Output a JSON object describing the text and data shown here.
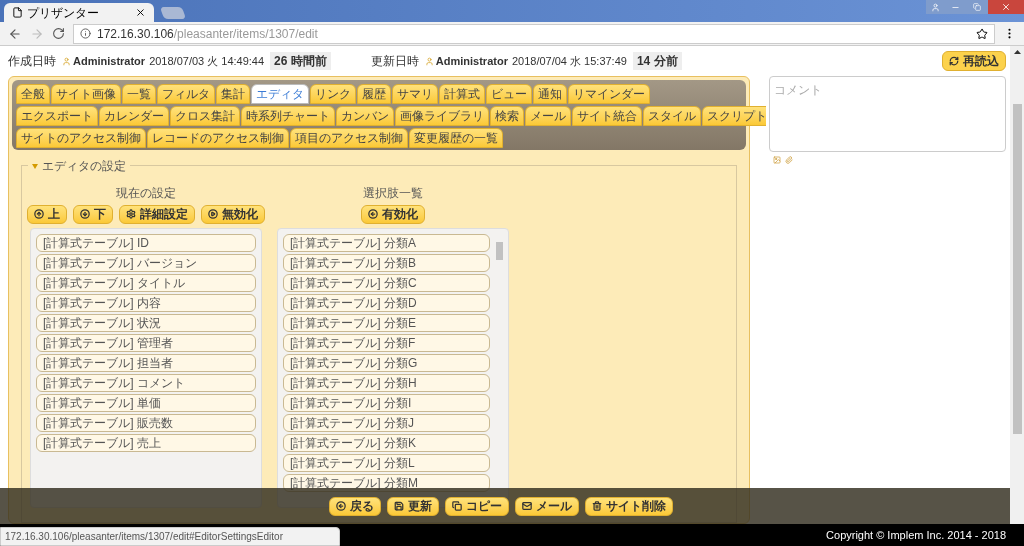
{
  "browser": {
    "tab_title": "プリザンター",
    "url_host": "172.16.30.106",
    "url_path": "/pleasanter/items/1307/edit"
  },
  "header": {
    "created_label": "作成日時",
    "created_user": "Administrator",
    "created_at": "2018/07/03 火 14:49:44",
    "created_ago": "26 時間前",
    "updated_label": "更新日時",
    "updated_user": "Administrator",
    "updated_at": "2018/07/04 水 15:37:49",
    "updated_ago": "14 分前",
    "reload_button": "再読込"
  },
  "tab_rows": [
    [
      {
        "label": "全般",
        "selected": false
      },
      {
        "label": "サイト画像",
        "selected": false
      },
      {
        "label": "一覧",
        "selected": false
      },
      {
        "label": "フィルタ",
        "selected": false
      },
      {
        "label": "集計",
        "selected": false
      },
      {
        "label": "エディタ",
        "selected": true
      },
      {
        "label": "リンク",
        "selected": false
      },
      {
        "label": "履歴",
        "selected": false
      },
      {
        "label": "サマリ",
        "selected": false
      },
      {
        "label": "計算式",
        "selected": false
      },
      {
        "label": "ビュー",
        "selected": false
      },
      {
        "label": "通知",
        "selected": false
      },
      {
        "label": "リマインダー",
        "selected": false
      }
    ],
    [
      {
        "label": "エクスポート",
        "selected": false
      },
      {
        "label": "カレンダー",
        "selected": false
      },
      {
        "label": "クロス集計",
        "selected": false
      },
      {
        "label": "時系列チャート",
        "selected": false
      },
      {
        "label": "カンバン",
        "selected": false
      },
      {
        "label": "画像ライブラリ",
        "selected": false
      },
      {
        "label": "検索",
        "selected": false
      },
      {
        "label": "メール",
        "selected": false
      },
      {
        "label": "サイト統合",
        "selected": false
      },
      {
        "label": "スタイル",
        "selected": false
      },
      {
        "label": "スクリプト",
        "selected": false
      }
    ],
    [
      {
        "label": "サイトのアクセス制御",
        "selected": false
      },
      {
        "label": "レコードのアクセス制御",
        "selected": false
      },
      {
        "label": "項目のアクセス制御",
        "selected": false
      },
      {
        "label": "変更履歴の一覧",
        "selected": false
      }
    ]
  ],
  "editor_settings": {
    "legend": "エディタの設定",
    "expanded": true,
    "current": {
      "heading": "現在の設定",
      "buttons": [
        "上",
        "下",
        "詳細設定",
        "無効化"
      ],
      "items": [
        "[計算式テーブル] ID",
        "[計算式テーブル] バージョン",
        "[計算式テーブル] タイトル",
        "[計算式テーブル] 内容",
        "[計算式テーブル] 状況",
        "[計算式テーブル] 管理者",
        "[計算式テーブル] 担当者",
        "[計算式テーブル] コメント",
        "[計算式テーブル] 単価",
        "[計算式テーブル] 販売数",
        "[計算式テーブル] 売上"
      ]
    },
    "choices": {
      "heading": "選択肢一覧",
      "buttons": [
        "有効化"
      ],
      "items": [
        "[計算式テーブル] 分類A",
        "[計算式テーブル] 分類B",
        "[計算式テーブル] 分類C",
        "[計算式テーブル] 分類D",
        "[計算式テーブル] 分類E",
        "[計算式テーブル] 分類F",
        "[計算式テーブル] 分類G",
        "[計算式テーブル] 分類H",
        "[計算式テーブル] 分類I",
        "[計算式テーブル] 分類J",
        "[計算式テーブル] 分類K",
        "[計算式テーブル] 分類L",
        "[計算式テーブル] 分類M"
      ]
    }
  },
  "comment": {
    "placeholder": "コメント"
  },
  "action_buttons": [
    "戻る",
    "更新",
    "コピー",
    "メール",
    "サイト削除"
  ],
  "footer": {
    "copyright": "Copyright © Implem Inc. 2014 - 2018"
  },
  "status_url": "172.16.30.106/pleasanter/items/1307/edit#EditorSettingsEditor"
}
